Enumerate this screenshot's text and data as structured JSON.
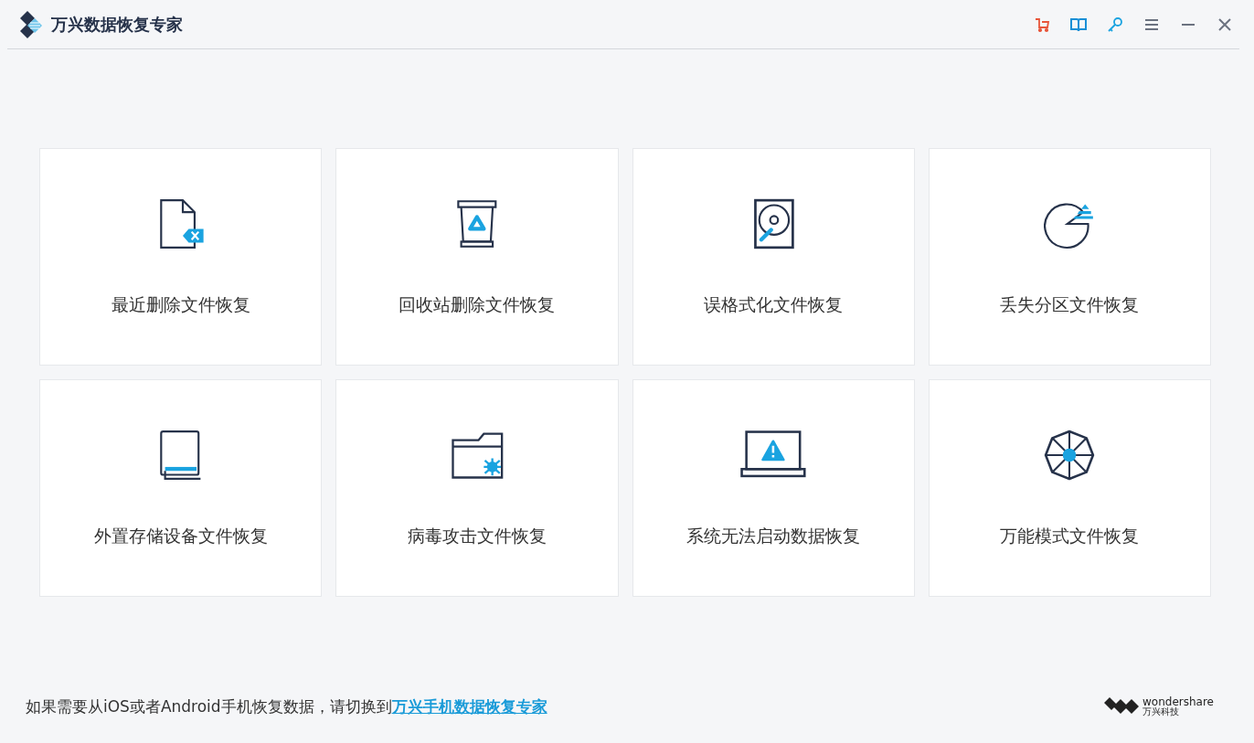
{
  "window": {
    "title": "万兴数据恢复专家"
  },
  "cards": [
    {
      "kind": "recent",
      "label": "最近删除文件恢复"
    },
    {
      "kind": "recycle",
      "label": "回收站删除文件恢复"
    },
    {
      "kind": "format",
      "label": "误格式化文件恢复"
    },
    {
      "kind": "partition",
      "label": "丢失分区文件恢复"
    },
    {
      "kind": "external",
      "label": "外置存储设备文件恢复"
    },
    {
      "kind": "virus",
      "label": "病毒攻击文件恢复"
    },
    {
      "kind": "crash",
      "label": "系统无法启动数据恢复"
    },
    {
      "kind": "all",
      "label": "万能模式文件恢复"
    }
  ],
  "footer": {
    "text": "如果需要从iOS或者Android手机恢复数据，请切换到",
    "link": "万兴手机数据恢复专家"
  },
  "brand": {
    "name": "wondershare",
    "subtitle": "万兴科技"
  }
}
